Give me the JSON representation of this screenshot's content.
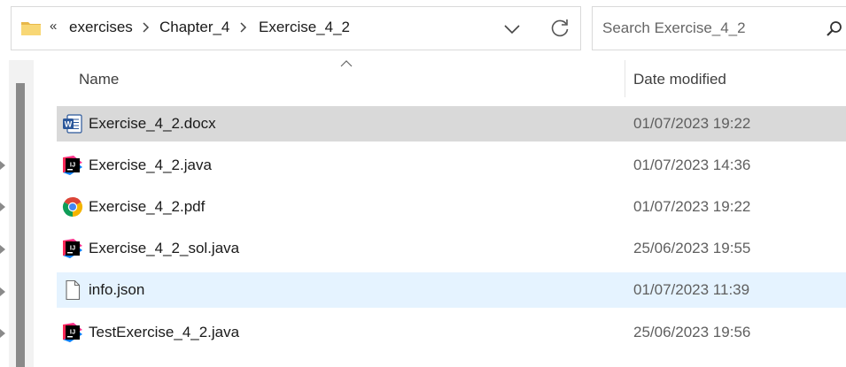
{
  "address_bar": {
    "overflow": "«",
    "breadcrumbs": [
      "exercises",
      "Chapter_4",
      "Exercise_4_2"
    ]
  },
  "search": {
    "placeholder": "Search Exercise_4_2"
  },
  "columns": {
    "name": "Name",
    "date_modified": "Date modified"
  },
  "files": [
    {
      "name": "Exercise_4_2.docx",
      "date": "01/07/2023 19:22",
      "icon": "word-doc-icon",
      "state": "selected"
    },
    {
      "name": "Exercise_4_2.java",
      "date": "01/07/2023 14:36",
      "icon": "intellij-icon",
      "state": "normal"
    },
    {
      "name": "Exercise_4_2.pdf",
      "date": "01/07/2023 19:22",
      "icon": "chrome-icon",
      "state": "normal"
    },
    {
      "name": "Exercise_4_2_sol.java",
      "date": "25/06/2023 19:55",
      "icon": "intellij-icon",
      "state": "normal"
    },
    {
      "name": "info.json",
      "date": "01/07/2023 11:39",
      "icon": "blank-file-icon",
      "state": "hovered"
    },
    {
      "name": "TestExercise_4_2.java",
      "date": "25/06/2023 19:56",
      "icon": "intellij-icon",
      "state": "normal"
    }
  ],
  "colors": {
    "selected_row": "#d9d9d9",
    "hover_row": "#e5f3ff",
    "folder": "#f8d775",
    "word_blue": "#2b579a"
  }
}
